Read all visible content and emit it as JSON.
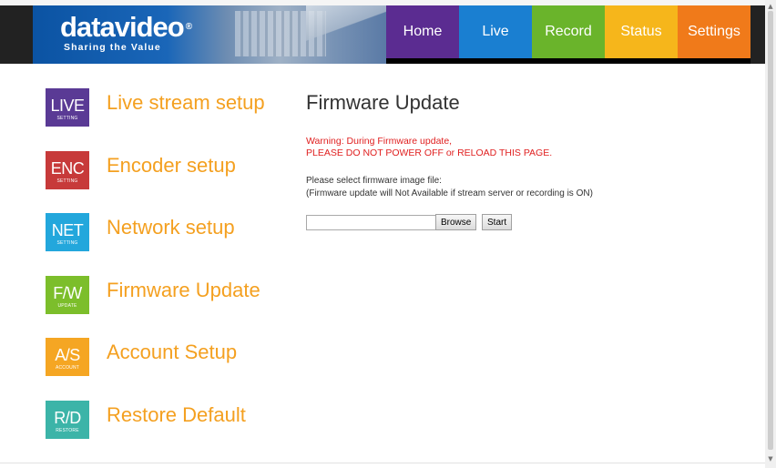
{
  "brand": {
    "logo": "datavideo",
    "trademark": "®",
    "tagline": "Sharing the Value"
  },
  "nav": [
    {
      "label": "Home",
      "color": "#5b2c91"
    },
    {
      "label": "Live",
      "color": "#1a7fd1"
    },
    {
      "label": "Record",
      "color": "#6ab42b"
    },
    {
      "label": "Status",
      "color": "#f6b61b"
    },
    {
      "label": "Settings",
      "color": "#f07a1a"
    }
  ],
  "sidebar": [
    {
      "abbr": "LIVE",
      "sub": "SETTING",
      "label": "Live stream setup",
      "color": "#5a3a95",
      "icon": "live-setting-icon"
    },
    {
      "abbr": "ENC",
      "sub": "SETTING",
      "label": "Encoder setup",
      "color": "#c73a3a",
      "icon": "encoder-setting-icon"
    },
    {
      "abbr": "NET",
      "sub": "SETTING",
      "label": "Network setup",
      "color": "#23a7dc",
      "icon": "network-setting-icon"
    },
    {
      "abbr": "F/W",
      "sub": "UPDATE",
      "label": "Firmware Update",
      "color": "#7cbe2b",
      "icon": "firmware-update-icon"
    },
    {
      "abbr": "A/S",
      "sub": "ACCOUNT",
      "label": "Account Setup",
      "color": "#f5a623",
      "icon": "account-setup-icon"
    },
    {
      "abbr": "R/D",
      "sub": "RESTORE",
      "label": "Restore Default",
      "color": "#3cb4a8",
      "icon": "restore-default-icon"
    }
  ],
  "main": {
    "title": "Firmware Update",
    "warning_line1": "Warning: During Firmware update,",
    "warning_line2": "PLEASE DO NOT POWER OFF or RELOAD THIS PAGE.",
    "note_line1": "Please select firmware image file:",
    "note_line2": "(Firmware update will Not Available if stream server or recording is ON)",
    "file_value": "",
    "browse_label": "Browse",
    "start_label": "Start"
  }
}
